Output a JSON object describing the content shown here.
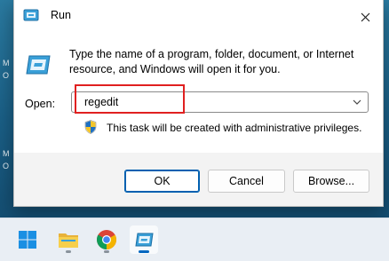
{
  "dialog": {
    "title": "Run",
    "description": "Type the name of a program, folder, document, or Internet resource, and Windows will open it for you.",
    "open_label": "Open:",
    "open_value": "regedit",
    "admin_notice": "This task will be created with administrative privileges.",
    "buttons": {
      "ok": "OK",
      "cancel": "Cancel",
      "browse": "Browse..."
    }
  },
  "desktop": {
    "labels": [
      "M",
      "O",
      "M",
      "O"
    ]
  },
  "taskbar": {
    "items": [
      {
        "name": "start",
        "icon": "windows-start-icon"
      },
      {
        "name": "file-explorer",
        "icon": "folder-icon"
      },
      {
        "name": "chrome",
        "icon": "chrome-icon"
      },
      {
        "name": "run",
        "icon": "run-icon",
        "active": true
      }
    ]
  },
  "colors": {
    "accent": "#0067c0",
    "highlight_box": "#e02020"
  }
}
